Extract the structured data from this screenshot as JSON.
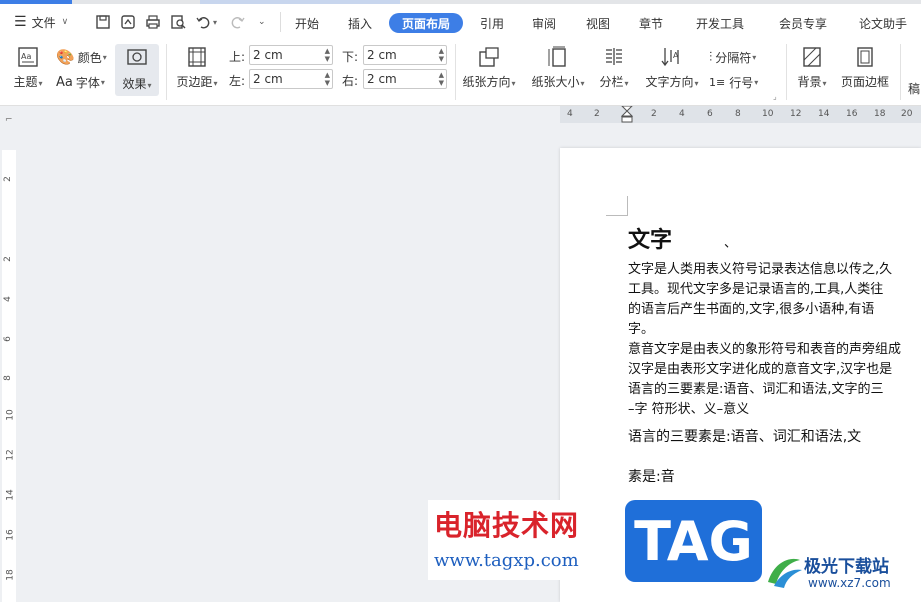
{
  "menubar": {
    "file_label": "文件",
    "tabs": [
      "开始",
      "插入",
      "页面布局",
      "引用",
      "审阅",
      "视图",
      "章节",
      "开发工具",
      "会员专享",
      "论文助手"
    ],
    "active_tab": "页面布局"
  },
  "ribbon": {
    "theme_label": "主题",
    "color_label": "颜色",
    "font_label": "字体",
    "effect_label": "效果",
    "margin_label": "页边距",
    "margin_top_label": "上:",
    "margin_top_value": "2 cm",
    "margin_bottom_label": "下:",
    "margin_bottom_value": "2 cm",
    "margin_left_label": "左:",
    "margin_left_value": "2 cm",
    "margin_right_label": "右:",
    "margin_right_value": "2 cm",
    "orientation_label": "纸张方向",
    "size_label": "纸张大小",
    "columns_label": "分栏",
    "text_direction_label": "文字方向",
    "separator_label": "分隔符",
    "line_number_label": "行号",
    "background_label": "背景",
    "page_border_label": "页面边框",
    "cut_label": "稿"
  },
  "hruler_labels": [
    "4",
    "2",
    "2",
    "4",
    "6",
    "8",
    "10",
    "12",
    "14",
    "16",
    "18",
    "20"
  ],
  "vruler_labels": [
    "2",
    "2",
    "4",
    "6",
    "8",
    "10",
    "12",
    "14",
    "16",
    "18"
  ],
  "document": {
    "heading": "文字",
    "heading_mark": "、",
    "lines": [
      "文字是人类用表义符号记录表达信息以传之,久",
      "工具。现代文字多是记录语言的,工具,人类往",
      "的语言后产生书面的,文字,很多小语种,有语",
      "字。",
      "意音文字是由表义的象形符号和表音的声旁组成",
      "汉字是由表形文字进化成的意音文字,汉字也是",
      "语言的三要素是:语音、词汇和语法,文字的三",
      "–字 符形状、义–意义"
    ],
    "line2": "语言的三要素是:语音、词汇和语法,文",
    "line3": "素是:音"
  },
  "watermark": {
    "site_name": "电脑技术网",
    "site_url": "www.tagxp.com",
    "tag": "TAG",
    "brand2": "极光下载站",
    "brand2_url": "www.xz7.com"
  }
}
